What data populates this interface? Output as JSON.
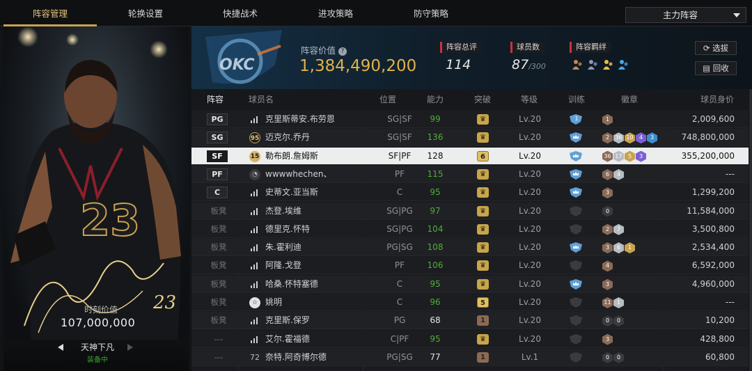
{
  "tabs": [
    {
      "label": "阵容管理",
      "active": true
    },
    {
      "label": "轮换设置",
      "active": false
    },
    {
      "label": "快捷战术",
      "active": false
    },
    {
      "label": "进攻策略",
      "active": false
    },
    {
      "label": "防守策略",
      "active": false
    }
  ],
  "lineup_select": "主力阵容",
  "card": {
    "value_label": "时刻价值",
    "value": "107,000,000",
    "skin_label": "天神下凡",
    "equipped_label": "装备中"
  },
  "info": {
    "value_label": "阵容价值",
    "lineup_value": "1,384,490,200",
    "overall_label": "阵容总评",
    "overall": "114",
    "count_label": "球员数",
    "count": "87",
    "count_max": "/300",
    "bonds_label": "阵容羁绊",
    "scout_button": "选拔",
    "recycle_button": "回收"
  },
  "headers": {
    "slot": "阵容",
    "name": "球员名",
    "position": "位置",
    "ability": "能力",
    "breakthrough": "突破",
    "level": "等级",
    "training": "训练",
    "badges": "徽章",
    "value": "球员身价"
  },
  "accent": "#c9a250",
  "players": [
    {
      "slot": "PG",
      "starter": true,
      "icon": "signal-icon",
      "name": "克里斯蒂安.布劳恩",
      "position": "SG|SF",
      "ability": "99",
      "ability_green": true,
      "breakthrough": "crown",
      "level": "Lv.20",
      "training": "1",
      "badges": [
        "1"
      ],
      "value": "2,009,600"
    },
    {
      "slot": "SG",
      "starter": true,
      "icon": "95",
      "name": "迈克尔.乔丹",
      "position": "SG|SF",
      "ability": "136",
      "ability_green": true,
      "breakthrough": "crown",
      "level": "Lv.20",
      "training": "crown",
      "badges": [
        "2",
        "36",
        "10",
        "4",
        "3"
      ],
      "value": "748,800,000"
    },
    {
      "slot": "SF",
      "starter": true,
      "selected": true,
      "icon": "15",
      "name": "勒布朗.詹姆斯",
      "position": "SF|PF",
      "ability": "128",
      "ability_green": false,
      "breakthrough": "6",
      "level": "Lv.20",
      "training": "crown",
      "badges": [
        "36",
        "17",
        "5",
        "3"
      ],
      "value": "355,200,000"
    },
    {
      "slot": "PF",
      "starter": true,
      "icon": "avatar-icon",
      "name": "wwwwhechen、",
      "position": "PF",
      "ability": "115",
      "ability_green": true,
      "breakthrough": "crown",
      "level": "Lv.20",
      "training": "crown",
      "badges": [
        "6",
        "4"
      ],
      "value": "---"
    },
    {
      "slot": "C",
      "starter": true,
      "icon": "signal-icon",
      "name": "史蒂文.亚当斯",
      "position": "C",
      "ability": "95",
      "ability_green": true,
      "breakthrough": "crown",
      "level": "Lv.20",
      "training": "crown",
      "badges": [
        "3"
      ],
      "value": "1,299,200"
    },
    {
      "slot": "板凳",
      "starter": false,
      "icon": "signal-icon",
      "name": "杰登.埃维",
      "position": "SG|PG",
      "ability": "97",
      "ability_green": true,
      "breakthrough": "crown",
      "level": "Lv.20",
      "training": "none",
      "badges": [
        "0"
      ],
      "value": "11,584,000"
    },
    {
      "slot": "板凳",
      "starter": false,
      "icon": "signal-icon",
      "name": "德里克.怀特",
      "position": "SG|PG",
      "ability": "104",
      "ability_green": true,
      "breakthrough": "crown",
      "level": "Lv.20",
      "training": "none",
      "badges": [
        "2",
        "7"
      ],
      "value": "3,500,800"
    },
    {
      "slot": "板凳",
      "starter": false,
      "icon": "signal-icon",
      "name": "朱.霍利迪",
      "position": "PG|SG",
      "ability": "108",
      "ability_green": true,
      "breakthrough": "crown",
      "level": "Lv.20",
      "training": "crown",
      "badges": [
        "3",
        "6",
        "1"
      ],
      "value": "2,534,400"
    },
    {
      "slot": "板凳",
      "starter": false,
      "icon": "signal-icon",
      "name": "阿隆.戈登",
      "position": "PF",
      "ability": "106",
      "ability_green": true,
      "breakthrough": "crown",
      "level": "Lv.20",
      "training": "none",
      "badges": [
        "4"
      ],
      "value": "6,592,000"
    },
    {
      "slot": "板凳",
      "starter": false,
      "icon": "signal-icon",
      "name": "哈桑.怀特塞德",
      "position": "C",
      "ability": "95",
      "ability_green": true,
      "breakthrough": "crown",
      "level": "Lv.20",
      "training": "crown",
      "badges": [
        "3"
      ],
      "value": "4,960,000"
    },
    {
      "slot": "板凳",
      "starter": false,
      "icon": "star-icon",
      "name": "姚明",
      "position": "C",
      "ability": "96",
      "ability_green": true,
      "breakthrough": "5",
      "level": "Lv.20",
      "training": "none",
      "badges": [
        "11",
        "1"
      ],
      "value": "---"
    },
    {
      "slot": "板凳",
      "starter": false,
      "icon": "signal-icon",
      "name": "克里斯.保罗",
      "position": "PG",
      "ability": "68",
      "ability_green": false,
      "breakthrough": "1",
      "level": "Lv.20",
      "training": "none",
      "badges": [
        "0",
        "0"
      ],
      "value": "10,200"
    },
    {
      "slot": "---",
      "starter": false,
      "icon": "signal-icon",
      "name": "艾尔.霍福德",
      "position": "C|PF",
      "ability": "95",
      "ability_green": true,
      "breakthrough": "crown",
      "level": "Lv.20",
      "training": "none",
      "badges": [
        "3"
      ],
      "value": "428,800"
    },
    {
      "slot": "---",
      "starter": false,
      "icon": "72",
      "name": "奈特.阿奇博尔德",
      "position": "PG|SG",
      "ability": "77",
      "ability_green": false,
      "breakthrough": "1",
      "level": "Lv.1",
      "training": "none",
      "badges": [
        "0",
        "0"
      ],
      "value": "60,800"
    }
  ]
}
